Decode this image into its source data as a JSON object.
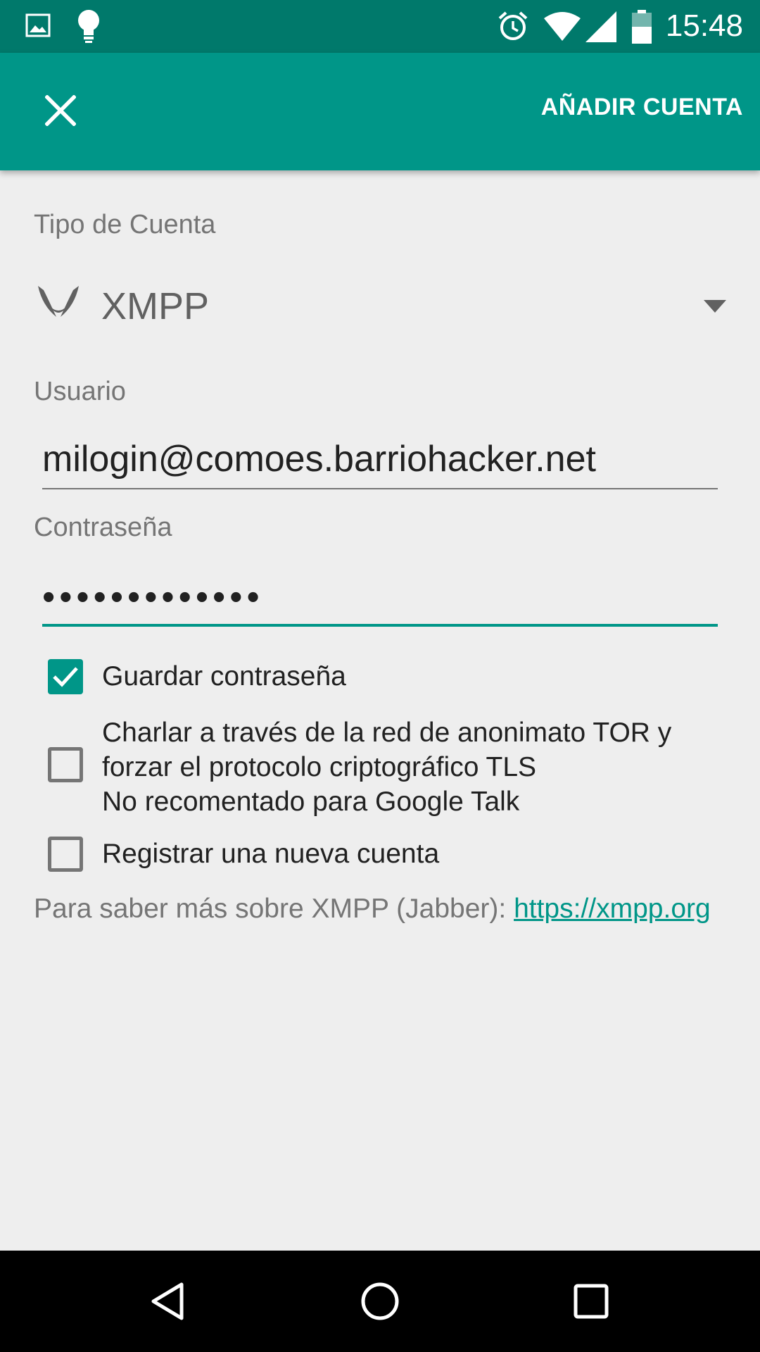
{
  "status_bar": {
    "time": "15:48",
    "icons": [
      "image-notification-icon",
      "lightbulb-notification-icon",
      "alarm-icon",
      "wifi-icon",
      "cellular-signal-icon",
      "battery-icon"
    ]
  },
  "app_bar": {
    "close_icon": "close-icon",
    "action_label": "AÑADIR CUENTA",
    "color": "#009688",
    "status_color": "#00796b"
  },
  "form": {
    "account_type_label": "Tipo de Cuenta",
    "account_type_value": "XMPP",
    "account_type_icon": "xmpp-logo-icon",
    "username_label": "Usuario",
    "username_value": "milogin@comoes.barriohacker.net",
    "password_label": "Contraseña",
    "password_display": "•••••••••••••",
    "checkboxes": [
      {
        "label": "Guardar contraseña",
        "checked": true
      },
      {
        "lines": [
          "Charlar a través de la red de anonimato TOR y",
          "forzar el protocolo criptográfico TLS",
          "No recomentado para Google Talk"
        ],
        "checked": false
      },
      {
        "label": "Registrar una nueva cuenta",
        "checked": false
      }
    ],
    "info_text": "Para saber más sobre XMPP (Jabber): ",
    "info_link": "https://xmpp.org"
  },
  "nav_bar": {
    "icons": [
      "back-icon",
      "home-icon",
      "recents-icon"
    ]
  },
  "colors": {
    "accent": "#009688",
    "background": "#eeeeee",
    "text_primary": "#212121",
    "text_secondary": "#757575"
  }
}
